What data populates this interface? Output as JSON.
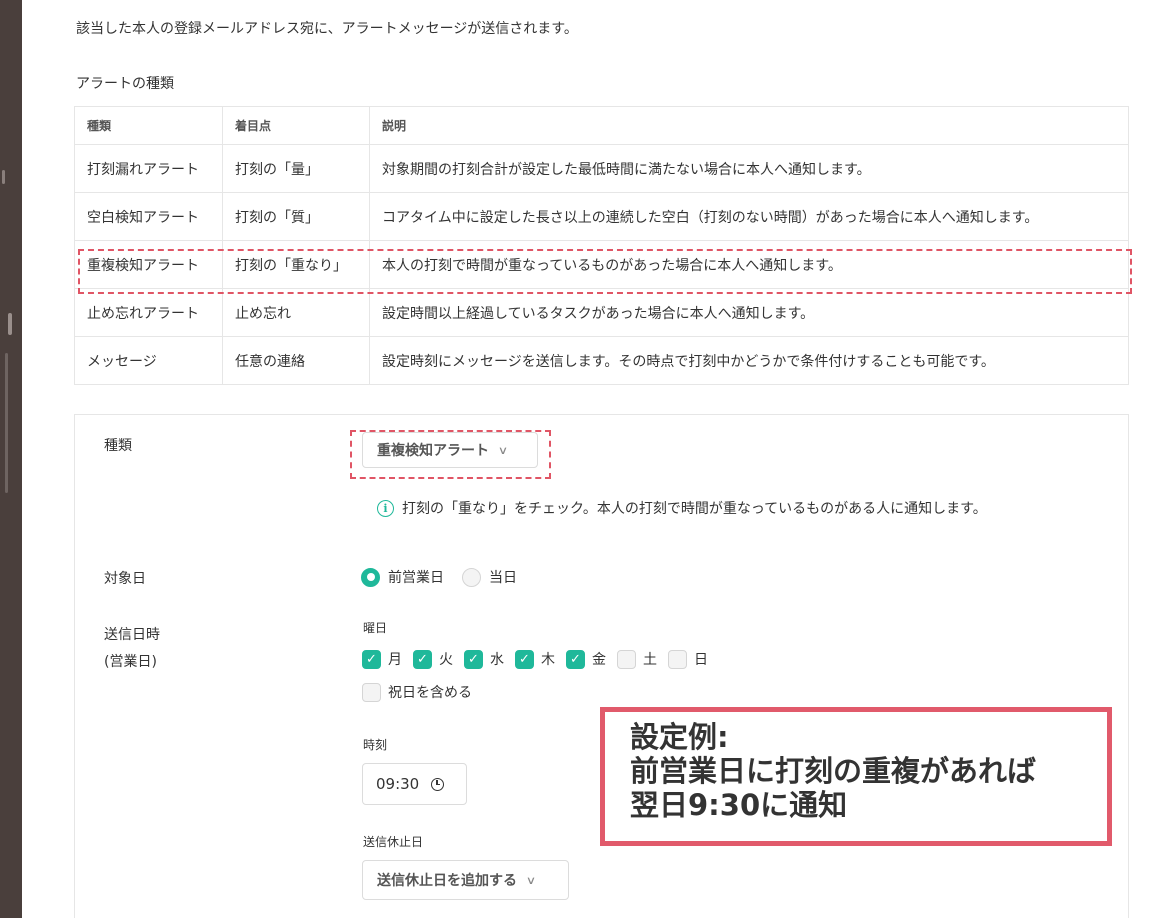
{
  "intro_text": "該当した本人の登録メールアドレス宛に、アラートメッセージが送信されます。",
  "alert_types_heading": "アラートの種類",
  "alert_table": {
    "headers": [
      "種類",
      "着目点",
      "説明"
    ],
    "rows": [
      [
        "打刻漏れアラート",
        "打刻の「量」",
        "対象期間の打刻合計が設定した最低時間に満たない場合に本人へ通知します。"
      ],
      [
        "空白検知アラート",
        "打刻の「質」",
        "コアタイム中に設定した長さ以上の連続した空白（打刻のない時間）があった場合に本人へ通知します。"
      ],
      [
        "重複検知アラート",
        "打刻の「重なり」",
        "本人の打刻で時間が重なっているものがあった場合に本人へ通知します。"
      ],
      [
        "止め忘れアラート",
        "止め忘れ",
        "設定時間以上経過しているタスクがあった場合に本人へ通知します。"
      ],
      [
        "メッセージ",
        "任意の連絡",
        "設定時刻にメッセージを送信します。その時点で打刻中かどうかで条件付けすることも可能です。"
      ]
    ]
  },
  "form": {
    "type_label": "種類",
    "type_value": "重複検知アラート",
    "type_info": "打刻の「重なり」をチェック。本人の打刻で時間が重なっているものがある人に通知します。",
    "target_day_label": "対象日",
    "target_day_options": [
      "前営業日",
      "当日"
    ],
    "target_day_selected": "前営業日",
    "send_label_line1": "送信日時",
    "send_label_line2": "(営業日)",
    "weekday_label": "曜日",
    "weekdays": [
      {
        "label": "月",
        "checked": true
      },
      {
        "label": "火",
        "checked": true
      },
      {
        "label": "水",
        "checked": true
      },
      {
        "label": "木",
        "checked": true
      },
      {
        "label": "金",
        "checked": true
      },
      {
        "label": "土",
        "checked": false
      },
      {
        "label": "日",
        "checked": false
      }
    ],
    "holiday_label": "祝日を含める",
    "holiday_checked": false,
    "time_label": "時刻",
    "time_value": "09:30",
    "suspend_label": "送信休止日",
    "suspend_button": "送信休止日を追加する"
  },
  "callout": {
    "line1": "設定例:",
    "line2": "前営業日に打刻の重複があれば",
    "line3": "翌日9:30に通知"
  },
  "colors": {
    "accent": "#1fb89a",
    "highlight": "#e05565",
    "sidebar": "#4a3f3c"
  }
}
